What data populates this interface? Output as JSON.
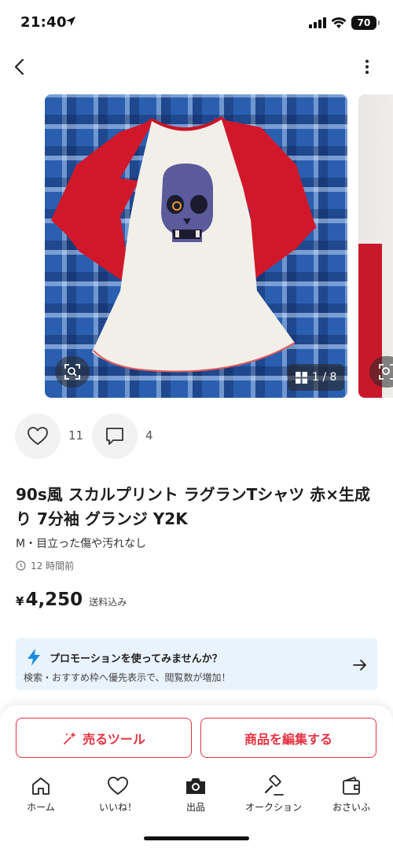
{
  "status_bar": {
    "time": "21:40",
    "battery": "70"
  },
  "icons": {
    "back": "chevron-left-icon",
    "more": "more-vertical-icon",
    "zoom": "image-search-icon",
    "gallery": "grid-icon",
    "like": "heart-icon",
    "comment": "comment-icon",
    "promo": "lightning-icon",
    "promo_arrow": "arrow-right-icon"
  },
  "gallery": {
    "counter": "1 / 8"
  },
  "actions": {
    "likes": "11",
    "comments": "4"
  },
  "item": {
    "title": "90s風 スカルプリント ラグランTシャツ 赤×生成り 7分袖 グランジ Y2K",
    "condition": "M・目立った傷や汚れなし",
    "posted": "12 時間前",
    "price_symbol": "¥",
    "price": "4,250",
    "shipping": "送料込み"
  },
  "promo": {
    "heading": "プロモーションを使ってみませんか？",
    "subtext": "検索・おすすめ枠へ優先表示で、閲覧数が増加！"
  },
  "buttons": {
    "sell_tools": "売るツール",
    "edit_item": "商品を編集する"
  },
  "tabs": [
    {
      "label": "ホーム",
      "icon": "home-icon"
    },
    {
      "label": "いいね！",
      "icon": "heart-icon"
    },
    {
      "label": "出品",
      "icon": "camera-icon"
    },
    {
      "label": "オークション",
      "icon": "gavel-icon"
    },
    {
      "label": "おさいふ",
      "icon": "wallet-icon"
    }
  ],
  "colors": {
    "accent": "#e8303f",
    "promo_bg": "#e9f3fc",
    "promo_icon": "#1a8be0"
  }
}
